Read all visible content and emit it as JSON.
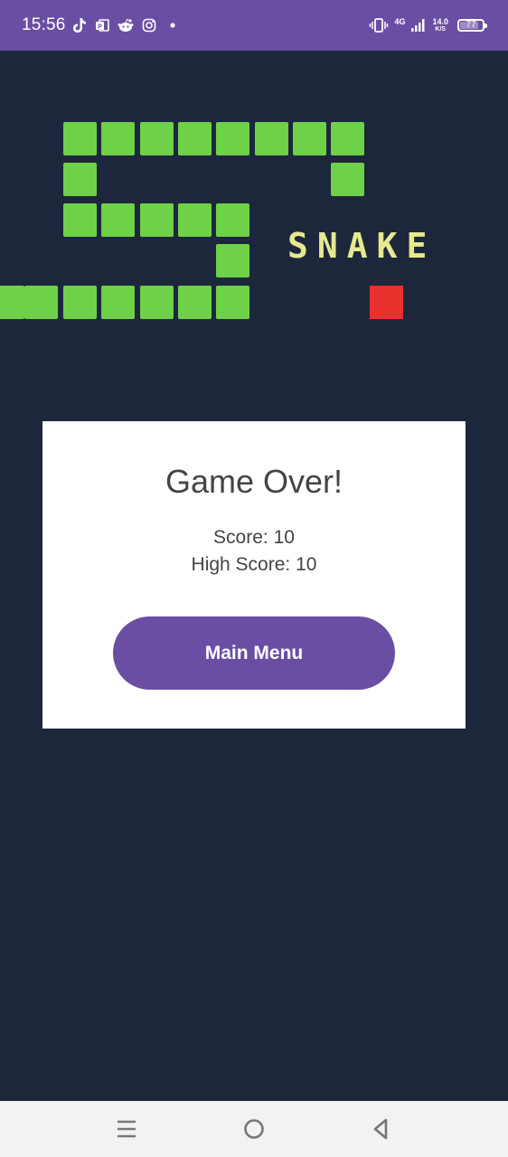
{
  "status_bar": {
    "time": "15:56",
    "network_type": "4G",
    "network_speed_value": "14.0",
    "network_speed_unit": "K/S",
    "battery_level": "77",
    "icons": [
      "tiktok-icon",
      "outlook-icon",
      "reddit-icon",
      "instagram-icon",
      "notification-dot-icon",
      "vibrate-icon",
      "signal-icon",
      "battery-icon"
    ]
  },
  "logo": {
    "word": "SNAKE",
    "colors": {
      "snake": "#6fd147",
      "food": "#e8302d",
      "word": "#e6ea8f"
    }
  },
  "dialog": {
    "title": "Game Over!",
    "score_text": "Score: 10",
    "high_score_text": "High Score: 10",
    "main_menu_label": "Main Menu"
  },
  "nav_bar": {
    "icons": [
      "recent-apps-icon",
      "home-icon",
      "back-icon"
    ]
  },
  "colors": {
    "background": "#1c273b",
    "accent": "#6a4ea3",
    "card": "#ffffff"
  }
}
